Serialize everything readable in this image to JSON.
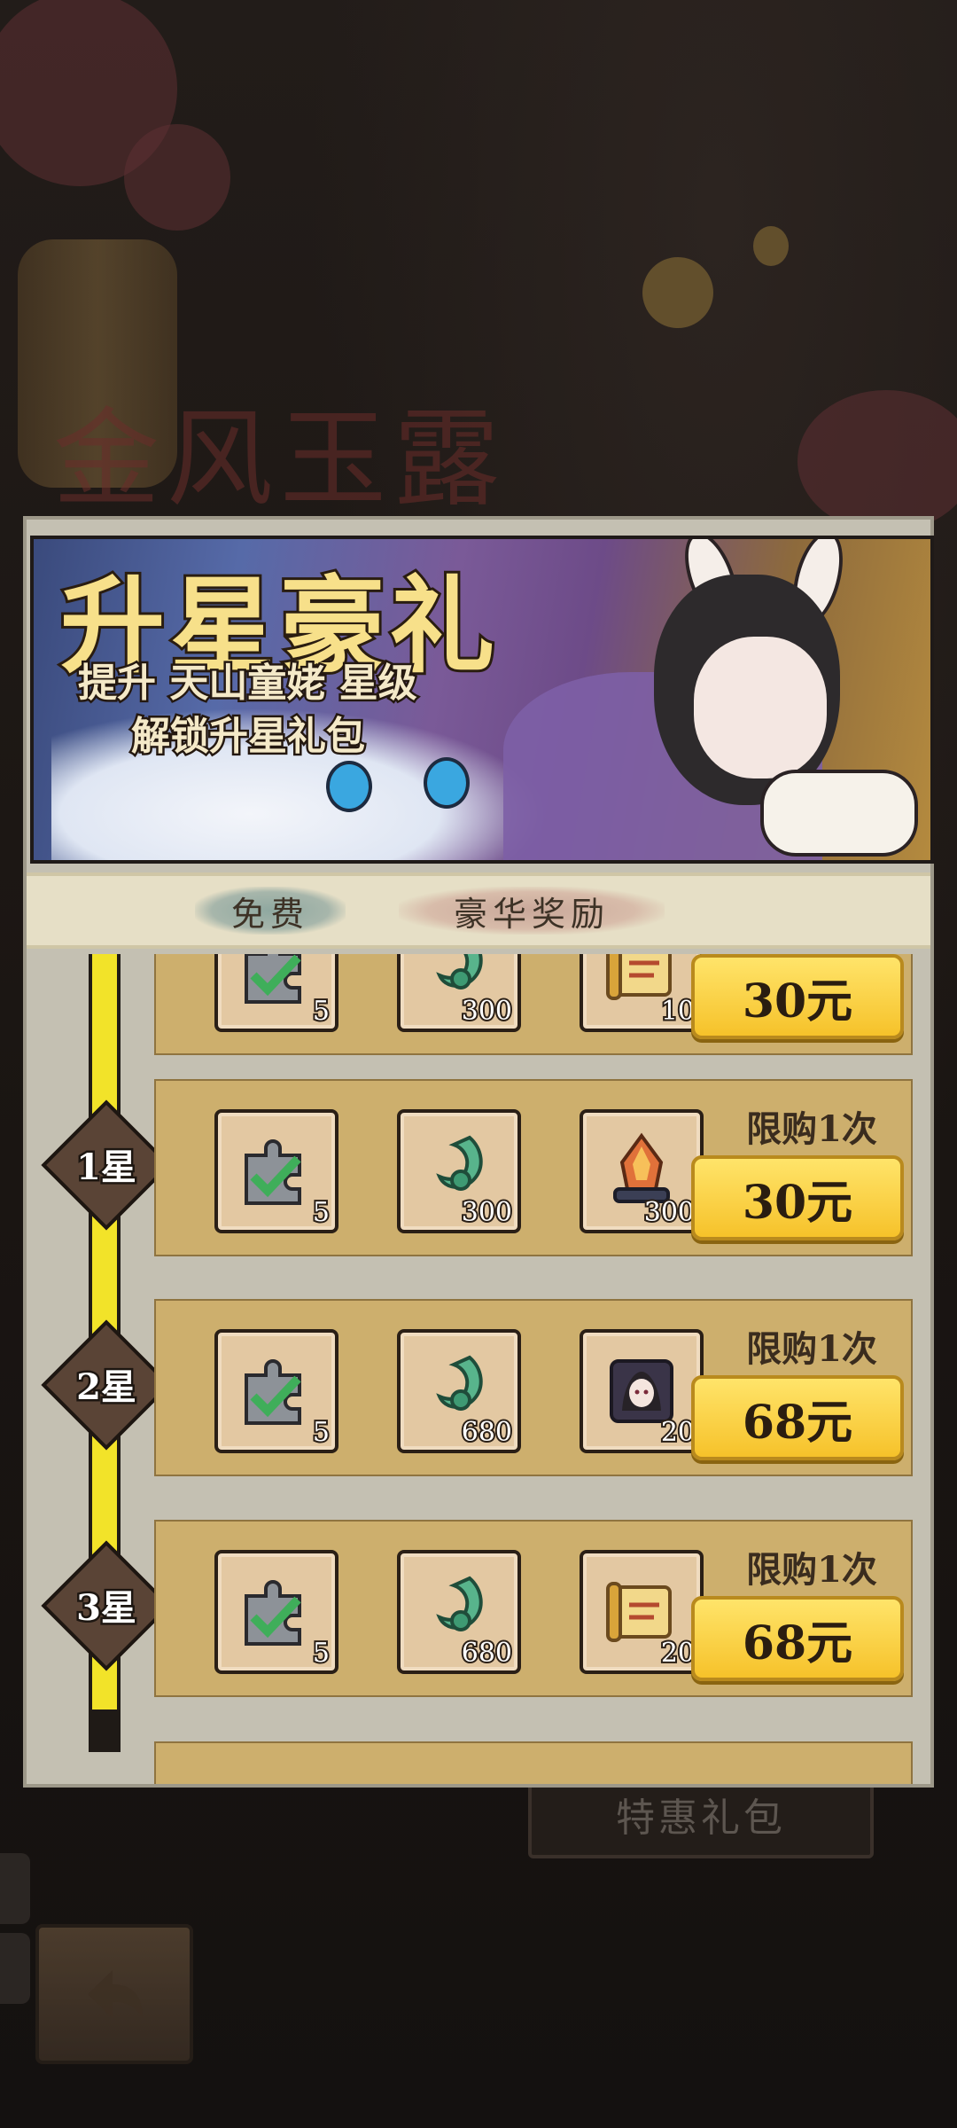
{
  "background": {
    "title": "金风玉露",
    "special_gift_label": "特惠礼包"
  },
  "banner": {
    "title": "升星豪礼",
    "subtitle_line1": "提升 天山童姥 星级",
    "subtitle_line2": "解锁升星礼包"
  },
  "tabs": [
    {
      "label": "免费"
    },
    {
      "label": "豪华奖励"
    }
  ],
  "tiers": [
    {
      "star": "",
      "limit": "",
      "price": "30元",
      "items": [
        {
          "icon": "puzzle-fragment-icon",
          "qty": "5"
        },
        {
          "icon": "jade-hook-icon",
          "qty": "300"
        },
        {
          "icon": "scroll-icon",
          "qty": "10"
        }
      ]
    },
    {
      "star": "1星",
      "limit": "限购1次",
      "price": "30元",
      "items": [
        {
          "icon": "puzzle-fragment-icon",
          "qty": "5"
        },
        {
          "icon": "jade-hook-icon",
          "qty": "300"
        },
        {
          "icon": "fire-crystal-icon",
          "qty": "300"
        }
      ]
    },
    {
      "star": "2星",
      "limit": "限购1次",
      "price": "68元",
      "items": [
        {
          "icon": "puzzle-fragment-icon",
          "qty": "5"
        },
        {
          "icon": "jade-hook-icon",
          "qty": "680"
        },
        {
          "icon": "character-portrait-icon",
          "qty": "20"
        }
      ]
    },
    {
      "star": "3星",
      "limit": "限购1次",
      "price": "68元",
      "items": [
        {
          "icon": "puzzle-fragment-icon",
          "qty": "5"
        },
        {
          "icon": "jade-hook-icon",
          "qty": "680"
        },
        {
          "icon": "scroll-icon",
          "qty": "20"
        }
      ]
    }
  ],
  "colors": {
    "progress_track": "#f2e329",
    "price_button": "#f6c22a",
    "tier_panel": "#cdaf6d"
  }
}
